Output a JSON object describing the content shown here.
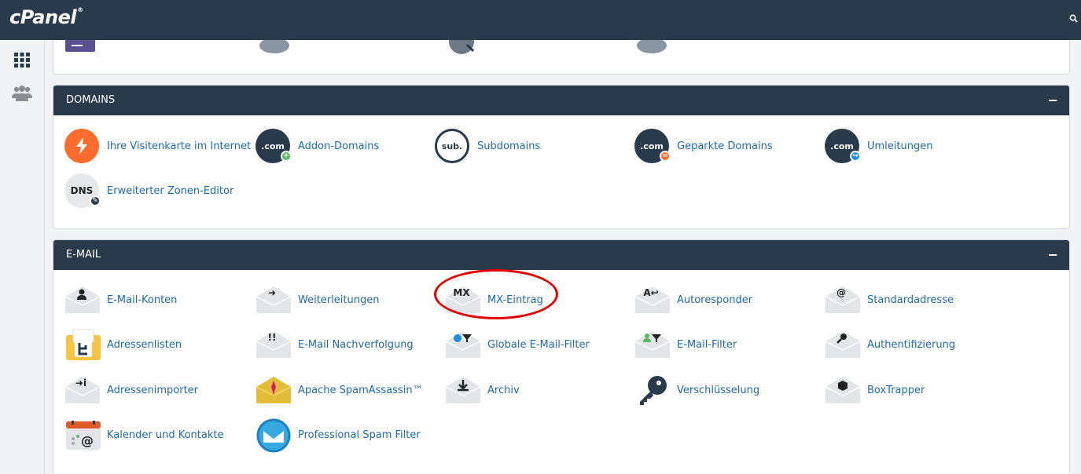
{
  "app": {
    "logo_text": "cPanel",
    "logo_mark": "®"
  },
  "nav": [
    {
      "name": "apps-grid-icon"
    },
    {
      "name": "users-icon"
    }
  ],
  "domains": {
    "title": "DOMAINS",
    "toggle": "−",
    "items": [
      {
        "label": "Ihre Visitenkarte im Internet",
        "icon": "lightning-icon"
      },
      {
        "label": "Addon-Domains",
        "icon": "dotcom-add-icon",
        "glyph": ".com"
      },
      {
        "label": "Subdomains",
        "icon": "sub-icon",
        "glyph": "sub."
      },
      {
        "label": "Geparkte Domains",
        "icon": "dotcom-parked-icon",
        "glyph": ".com"
      },
      {
        "label": "Umleitungen",
        "icon": "dotcom-redirect-icon",
        "glyph": ".com"
      },
      {
        "label": "Erweiterter Zonen-Editor",
        "icon": "dns-editor-icon",
        "glyph": "DNS"
      }
    ]
  },
  "email": {
    "title": "E-MAIL",
    "toggle": "−",
    "items": [
      {
        "label": "E-Mail-Konten",
        "icon": "email-accounts-icon",
        "glyph": "👤"
      },
      {
        "label": "Weiterleitungen",
        "icon": "forwarders-icon",
        "glyph": "➜"
      },
      {
        "label": "MX-Eintrag",
        "icon": "mx-entry-icon",
        "glyph": "MX"
      },
      {
        "label": "Autoresponder",
        "icon": "autoresponder-icon",
        "glyph": "A↩"
      },
      {
        "label": "Standardadresse",
        "icon": "default-address-icon",
        "glyph": "@"
      },
      {
        "label": "Adressenlisten",
        "icon": "mailing-lists-icon",
        "glyph": "⊨"
      },
      {
        "label": "E-Mail Nachverfolgung",
        "icon": "email-tracking-icon",
        "glyph": "!!"
      },
      {
        "label": "Globale E-Mail-Filter",
        "icon": "global-filter-icon",
        "glyph": "●▼"
      },
      {
        "label": "E-Mail-Filter",
        "icon": "email-filter-icon",
        "glyph": "👤▼"
      },
      {
        "label": "Authentifizierung",
        "icon": "authentication-icon",
        "glyph": "🔑"
      },
      {
        "label": "Adressenimporter",
        "icon": "address-importer-icon",
        "glyph": "➜i"
      },
      {
        "label": "Apache SpamAssassin™",
        "icon": "spamassassin-icon",
        "glyph": "✦"
      },
      {
        "label": "Archiv",
        "icon": "archive-icon",
        "glyph": "⬇"
      },
      {
        "label": "Verschlüsselung",
        "icon": "encryption-key-icon"
      },
      {
        "label": "BoxTrapper",
        "icon": "boxtrapper-icon",
        "glyph": "⬢"
      },
      {
        "label": "Kalender und Kontakte",
        "icon": "calendar-contacts-icon",
        "glyph": "@"
      },
      {
        "label": "Professional Spam Filter",
        "icon": "spam-filter-icon"
      }
    ]
  },
  "colors": {
    "navy": "#293a4a",
    "link": "#1f6aa8",
    "highlight": "#e20000",
    "orange": "#ff6c2c",
    "green": "#5cb85c",
    "blue": "#1e90e0"
  }
}
